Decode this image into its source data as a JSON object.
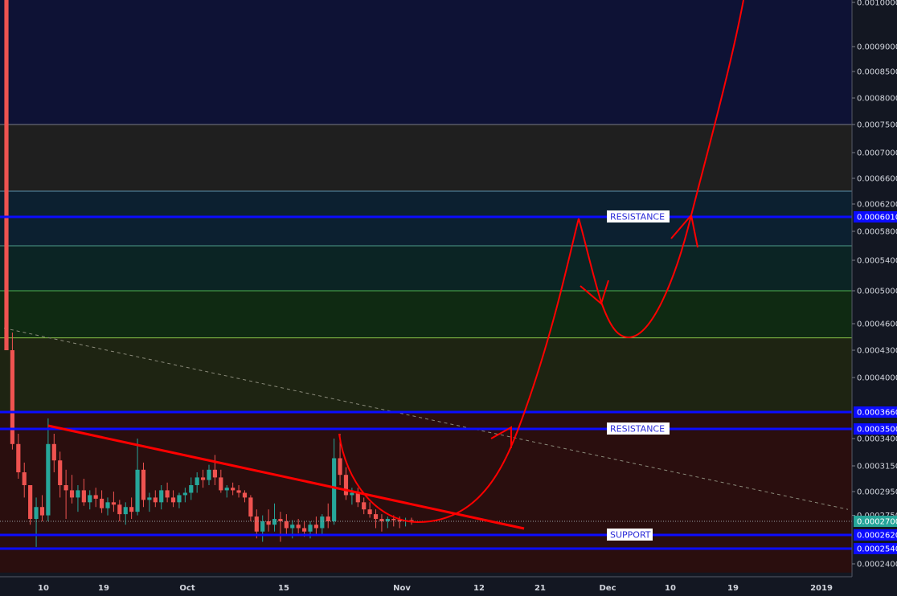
{
  "chart_data": {
    "type": "candlestick",
    "price_axis": {
      "ticks": [
        "0.0010000",
        "0.0009000",
        "0.0008500",
        "0.0008000",
        "0.0007500",
        "0.0007000",
        "0.0006600",
        "0.0006200",
        "0.0005800",
        "0.0005400",
        "0.0005000",
        "0.0004600",
        "0.0004300",
        "0.0004000",
        "0.0003400",
        "0.0003150",
        "0.0002950",
        "0.0002750",
        "0.0002400"
      ],
      "ylim": [
        0.000232,
        0.00101
      ]
    },
    "time_axis": {
      "ticks": [
        "10",
        "19",
        "Oct",
        "15",
        "Nov",
        "12",
        "21",
        "Dec",
        "10",
        "19",
        "2019"
      ]
    },
    "highlighted_levels": [
      {
        "label": "0.0003660",
        "value": 0.000366,
        "color": "#0c0cff"
      },
      {
        "label": "0.0003500",
        "value": 0.00035,
        "color": "#0c0cff"
      },
      {
        "label": "0.0006010",
        "value": 0.000601,
        "color": "#0c0cff"
      },
      {
        "label": "0.0002620",
        "value": 0.000262,
        "color": "#0c0cff"
      },
      {
        "label": "0.0002540",
        "value": 0.000254,
        "color": "#0c0cff"
      },
      {
        "label": "0.0002700",
        "value": 0.00027,
        "color": "#26a69a"
      }
    ],
    "bands": [
      {
        "from": 0.00075,
        "to": 0.00101,
        "color": "#0e1235"
      },
      {
        "from": 0.00064,
        "to": 0.00075,
        "color": "#1f1f1f"
      },
      {
        "from": 0.00056,
        "to": 0.00064,
        "color": "#0c2030"
      },
      {
        "from": 0.0005,
        "to": 0.00056,
        "color": "#0b2424"
      },
      {
        "from": 0.000444,
        "to": 0.0005,
        "color": "#0f2a12"
      },
      {
        "from": 0.000366,
        "to": 0.000444,
        "color": "#1e2412"
      },
      {
        "from": 0.000232,
        "to": 0.000366,
        "color": "#2a0e0e"
      }
    ],
    "fib_levels": [
      0.00075,
      0.00064,
      0.00056,
      0.0005,
      0.000444
    ],
    "annotations": [
      {
        "text": "RESISTANCE",
        "price": 0.000601
      },
      {
        "text": "RESISTANCE",
        "price": 0.00035
      },
      {
        "text": "SUPPORT",
        "price": 0.000262
      }
    ],
    "candles": [
      {
        "o": 0.00101,
        "h": 0.00101,
        "l": 0.00043,
        "c": 0.00043
      },
      {
        "o": 0.00043,
        "h": 0.00045,
        "l": 0.00033,
        "c": 0.000335
      },
      {
        "o": 0.000335,
        "h": 0.000345,
        "l": 0.000305,
        "c": 0.00031
      },
      {
        "o": 0.00031,
        "h": 0.000318,
        "l": 0.00029,
        "c": 0.0003
      },
      {
        "o": 0.0003,
        "h": 0.0003,
        "l": 0.000268,
        "c": 0.000272
      },
      {
        "o": 0.000272,
        "h": 0.00029,
        "l": 0.000255,
        "c": 0.000282
      },
      {
        "o": 0.000282,
        "h": 0.000292,
        "l": 0.00027,
        "c": 0.000275
      },
      {
        "o": 0.000275,
        "h": 0.00036,
        "l": 0.00027,
        "c": 0.000335
      },
      {
        "o": 0.000335,
        "h": 0.000345,
        "l": 0.00031,
        "c": 0.00032
      },
      {
        "o": 0.00032,
        "h": 0.000328,
        "l": 0.00029,
        "c": 0.0003
      },
      {
        "o": 0.0003,
        "h": 0.000312,
        "l": 0.000272,
        "c": 0.000296
      },
      {
        "o": 0.000296,
        "h": 0.000308,
        "l": 0.000285,
        "c": 0.00029
      },
      {
        "o": 0.00029,
        "h": 0.0003,
        "l": 0.000278,
        "c": 0.000296
      },
      {
        "o": 0.000296,
        "h": 0.000305,
        "l": 0.000283,
        "c": 0.000286
      },
      {
        "o": 0.000286,
        "h": 0.000296,
        "l": 0.00028,
        "c": 0.000292
      },
      {
        "o": 0.000292,
        "h": 0.000298,
        "l": 0.000282,
        "c": 0.000289
      },
      {
        "o": 0.000289,
        "h": 0.000296,
        "l": 0.000277,
        "c": 0.000281
      },
      {
        "o": 0.000281,
        "h": 0.00029,
        "l": 0.000275,
        "c": 0.000286
      },
      {
        "o": 0.000286,
        "h": 0.000295,
        "l": 0.000278,
        "c": 0.000284
      },
      {
        "o": 0.000284,
        "h": 0.000288,
        "l": 0.00027,
        "c": 0.000276
      },
      {
        "o": 0.000276,
        "h": 0.000286,
        "l": 0.000268,
        "c": 0.000282
      },
      {
        "o": 0.000282,
        "h": 0.00029,
        "l": 0.000272,
        "c": 0.000278
      },
      {
        "o": 0.000278,
        "h": 0.00034,
        "l": 0.000275,
        "c": 0.000312
      },
      {
        "o": 0.000312,
        "h": 0.000318,
        "l": 0.000282,
        "c": 0.000288
      },
      {
        "o": 0.000288,
        "h": 0.000294,
        "l": 0.000278,
        "c": 0.00029
      },
      {
        "o": 0.00029,
        "h": 0.000296,
        "l": 0.000282,
        "c": 0.000286
      },
      {
        "o": 0.000286,
        "h": 0.0003,
        "l": 0.00028,
        "c": 0.000296
      },
      {
        "o": 0.000296,
        "h": 0.000302,
        "l": 0.000286,
        "c": 0.00029
      },
      {
        "o": 0.00029,
        "h": 0.000296,
        "l": 0.000282,
        "c": 0.000286
      },
      {
        "o": 0.000286,
        "h": 0.000294,
        "l": 0.000281,
        "c": 0.000292
      },
      {
        "o": 0.000292,
        "h": 0.000298,
        "l": 0.000286,
        "c": 0.000294
      },
      {
        "o": 0.000294,
        "h": 0.000306,
        "l": 0.000288,
        "c": 0.0003
      },
      {
        "o": 0.0003,
        "h": 0.00031,
        "l": 0.000294,
        "c": 0.000306
      },
      {
        "o": 0.000306,
        "h": 0.000312,
        "l": 0.000298,
        "c": 0.000304
      },
      {
        "o": 0.000304,
        "h": 0.000316,
        "l": 0.0003,
        "c": 0.000312
      },
      {
        "o": 0.000312,
        "h": 0.000325,
        "l": 0.0003,
        "c": 0.000306
      },
      {
        "o": 0.000306,
        "h": 0.000312,
        "l": 0.000294,
        "c": 0.000296
      },
      {
        "o": 0.000296,
        "h": 0.0003,
        "l": 0.00029,
        "c": 0.000298
      },
      {
        "o": 0.000298,
        "h": 0.000302,
        "l": 0.000292,
        "c": 0.000296
      },
      {
        "o": 0.000296,
        "h": 0.0003,
        "l": 0.00029,
        "c": 0.000294
      },
      {
        "o": 0.000294,
        "h": 0.000296,
        "l": 0.000286,
        "c": 0.00029
      },
      {
        "o": 0.00029,
        "h": 0.000292,
        "l": 0.00027,
        "c": 0.000274
      },
      {
        "o": 0.000274,
        "h": 0.00028,
        "l": 0.00026,
        "c": 0.000264
      },
      {
        "o": 0.000264,
        "h": 0.000275,
        "l": 0.000258,
        "c": 0.00027
      },
      {
        "o": 0.00027,
        "h": 0.00028,
        "l": 0.000264,
        "c": 0.000268
      },
      {
        "o": 0.000268,
        "h": 0.000285,
        "l": 0.000264,
        "c": 0.000272
      },
      {
        "o": 0.000272,
        "h": 0.000278,
        "l": 0.000258,
        "c": 0.00027
      },
      {
        "o": 0.00027,
        "h": 0.000276,
        "l": 0.000262,
        "c": 0.000266
      },
      {
        "o": 0.000266,
        "h": 0.000271,
        "l": 0.00026,
        "c": 0.000268
      },
      {
        "o": 0.000268,
        "h": 0.000272,
        "l": 0.000263,
        "c": 0.000266
      },
      {
        "o": 0.000266,
        "h": 0.00027,
        "l": 0.000261,
        "c": 0.000264
      },
      {
        "o": 0.000264,
        "h": 0.00027,
        "l": 0.00026,
        "c": 0.000268
      },
      {
        "o": 0.000268,
        "h": 0.000274,
        "l": 0.000262,
        "c": 0.000266
      },
      {
        "o": 0.000266,
        "h": 0.000276,
        "l": 0.000262,
        "c": 0.000274
      },
      {
        "o": 0.000274,
        "h": 0.000285,
        "l": 0.000266,
        "c": 0.00027
      },
      {
        "o": 0.00027,
        "h": 0.00034,
        "l": 0.000268,
        "c": 0.000322
      },
      {
        "o": 0.000322,
        "h": 0.000345,
        "l": 0.0003,
        "c": 0.000308
      },
      {
        "o": 0.000308,
        "h": 0.000314,
        "l": 0.000288,
        "c": 0.000292
      },
      {
        "o": 0.000292,
        "h": 0.000298,
        "l": 0.000284,
        "c": 0.000294
      },
      {
        "o": 0.000294,
        "h": 0.000298,
        "l": 0.000282,
        "c": 0.000286
      },
      {
        "o": 0.000286,
        "h": 0.00029,
        "l": 0.000276,
        "c": 0.00028
      },
      {
        "o": 0.00028,
        "h": 0.000286,
        "l": 0.000273,
        "c": 0.000276
      },
      {
        "o": 0.000276,
        "h": 0.00028,
        "l": 0.000266,
        "c": 0.000272
      },
      {
        "o": 0.000272,
        "h": 0.000276,
        "l": 0.000264,
        "c": 0.00027
      },
      {
        "o": 0.00027,
        "h": 0.000274,
        "l": 0.000266,
        "c": 0.000272
      },
      {
        "o": 0.000272,
        "h": 0.000275,
        "l": 0.000267,
        "c": 0.000271
      },
      {
        "o": 0.000271,
        "h": 0.000274,
        "l": 0.000266,
        "c": 0.00027
      },
      {
        "o": 0.00027,
        "h": 0.000273,
        "l": 0.000267,
        "c": 0.000271
      },
      {
        "o": 0.000271,
        "h": 0.000273,
        "l": 0.000268,
        "c": 0.00027
      }
    ]
  }
}
